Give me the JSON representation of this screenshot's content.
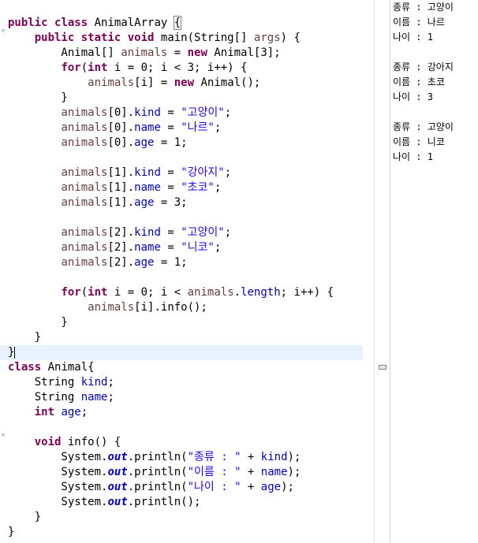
{
  "editor": {
    "lines": [
      [
        {
          "t": "public",
          "c": "kw"
        },
        {
          "t": " "
        },
        {
          "t": "class",
          "c": "kw"
        },
        {
          "t": " AnimalArray "
        },
        {
          "t": "{",
          "c": "bracket"
        }
      ],
      [
        {
          "t": "    "
        },
        {
          "t": "public",
          "c": "kw"
        },
        {
          "t": " "
        },
        {
          "t": "static",
          "c": "kw"
        },
        {
          "t": " "
        },
        {
          "t": "void",
          "c": "kw"
        },
        {
          "t": " main(String[] "
        },
        {
          "t": "args",
          "c": "var"
        },
        {
          "t": ") {"
        }
      ],
      [
        {
          "t": "        Animal[] "
        },
        {
          "t": "animals",
          "c": "var"
        },
        {
          "t": " = "
        },
        {
          "t": "new",
          "c": "kw"
        },
        {
          "t": " Animal[3];"
        }
      ],
      [
        {
          "t": "        "
        },
        {
          "t": "for",
          "c": "kw"
        },
        {
          "t": "("
        },
        {
          "t": "int",
          "c": "kw"
        },
        {
          "t": " i = 0; i < 3; i++) {"
        }
      ],
      [
        {
          "t": "            "
        },
        {
          "t": "animals",
          "c": "var"
        },
        {
          "t": "[i] = "
        },
        {
          "t": "new",
          "c": "kw"
        },
        {
          "t": " Animal();"
        }
      ],
      [
        {
          "t": "        }"
        }
      ],
      [
        {
          "t": "        "
        },
        {
          "t": "animals",
          "c": "var"
        },
        {
          "t": "[0]."
        },
        {
          "t": "kind",
          "c": "fld"
        },
        {
          "t": " = "
        },
        {
          "t": "\"고양이\"",
          "c": "str"
        },
        {
          "t": ";"
        }
      ],
      [
        {
          "t": "        "
        },
        {
          "t": "animals",
          "c": "var"
        },
        {
          "t": "[0]."
        },
        {
          "t": "name",
          "c": "fld"
        },
        {
          "t": " = "
        },
        {
          "t": "\"나르\"",
          "c": "str"
        },
        {
          "t": ";"
        }
      ],
      [
        {
          "t": "        "
        },
        {
          "t": "animals",
          "c": "var"
        },
        {
          "t": "[0]."
        },
        {
          "t": "age",
          "c": "fld"
        },
        {
          "t": " = 1;"
        }
      ],
      [],
      [
        {
          "t": "        "
        },
        {
          "t": "animals",
          "c": "var"
        },
        {
          "t": "[1]."
        },
        {
          "t": "kind",
          "c": "fld"
        },
        {
          "t": " = "
        },
        {
          "t": "\"강아지\"",
          "c": "str"
        },
        {
          "t": ";"
        }
      ],
      [
        {
          "t": "        "
        },
        {
          "t": "animals",
          "c": "var"
        },
        {
          "t": "[1]."
        },
        {
          "t": "name",
          "c": "fld"
        },
        {
          "t": " = "
        },
        {
          "t": "\"초코\"",
          "c": "str"
        },
        {
          "t": ";"
        }
      ],
      [
        {
          "t": "        "
        },
        {
          "t": "animals",
          "c": "var"
        },
        {
          "t": "[1]."
        },
        {
          "t": "age",
          "c": "fld"
        },
        {
          "t": " = 3;"
        }
      ],
      [],
      [
        {
          "t": "        "
        },
        {
          "t": "animals",
          "c": "var"
        },
        {
          "t": "[2]."
        },
        {
          "t": "kind",
          "c": "fld"
        },
        {
          "t": " = "
        },
        {
          "t": "\"고양이\"",
          "c": "str"
        },
        {
          "t": ";"
        }
      ],
      [
        {
          "t": "        "
        },
        {
          "t": "animals",
          "c": "var"
        },
        {
          "t": "[2]."
        },
        {
          "t": "name",
          "c": "fld"
        },
        {
          "t": " = "
        },
        {
          "t": "\"니코\"",
          "c": "str"
        },
        {
          "t": ";"
        }
      ],
      [
        {
          "t": "        "
        },
        {
          "t": "animals",
          "c": "var"
        },
        {
          "t": "[2]."
        },
        {
          "t": "age",
          "c": "fld"
        },
        {
          "t": " = 1;"
        }
      ],
      [],
      [
        {
          "t": "        "
        },
        {
          "t": "for",
          "c": "kw"
        },
        {
          "t": "("
        },
        {
          "t": "int",
          "c": "kw"
        },
        {
          "t": " i = 0; i < "
        },
        {
          "t": "animals",
          "c": "var"
        },
        {
          "t": "."
        },
        {
          "t": "length",
          "c": "fld"
        },
        {
          "t": "; i++) {"
        }
      ],
      [
        {
          "t": "            "
        },
        {
          "t": "animals",
          "c": "var"
        },
        {
          "t": "[i].info();"
        }
      ],
      [
        {
          "t": "        }"
        }
      ],
      [
        {
          "t": "    }"
        }
      ],
      [
        {
          "t": "}",
          "c": "caret-after"
        }
      ],
      [
        {
          "t": "class",
          "c": "kw"
        },
        {
          "t": " Animal{"
        }
      ],
      [
        {
          "t": "    String "
        },
        {
          "t": "kind",
          "c": "fld"
        },
        {
          "t": ";"
        }
      ],
      [
        {
          "t": "    String "
        },
        {
          "t": "name",
          "c": "fld"
        },
        {
          "t": ";"
        }
      ],
      [
        {
          "t": "    "
        },
        {
          "t": "int",
          "c": "kw"
        },
        {
          "t": " "
        },
        {
          "t": "age",
          "c": "fld"
        },
        {
          "t": ";"
        }
      ],
      [],
      [
        {
          "t": "    "
        },
        {
          "t": "void",
          "c": "kw"
        },
        {
          "t": " info() {"
        }
      ],
      [
        {
          "t": "        System."
        },
        {
          "t": "out",
          "c": "st"
        },
        {
          "t": ".println("
        },
        {
          "t": "\"종류 : \"",
          "c": "str"
        },
        {
          "t": " + "
        },
        {
          "t": "kind",
          "c": "fld"
        },
        {
          "t": ");"
        }
      ],
      [
        {
          "t": "        System."
        },
        {
          "t": "out",
          "c": "st"
        },
        {
          "t": ".println("
        },
        {
          "t": "\"이름 : \"",
          "c": "str"
        },
        {
          "t": " + "
        },
        {
          "t": "name",
          "c": "fld"
        },
        {
          "t": ");"
        }
      ],
      [
        {
          "t": "        System."
        },
        {
          "t": "out",
          "c": "st"
        },
        {
          "t": ".println("
        },
        {
          "t": "\"나이 : \"",
          "c": "str"
        },
        {
          "t": " + "
        },
        {
          "t": "age",
          "c": "fld"
        },
        {
          "t": ");"
        }
      ],
      [
        {
          "t": "        System."
        },
        {
          "t": "out",
          "c": "st"
        },
        {
          "t": ".println();"
        }
      ],
      [
        {
          "t": "    }"
        }
      ],
      [
        {
          "t": "}"
        }
      ]
    ],
    "current_line": 22,
    "fold_markers": [
      1,
      28
    ]
  },
  "console": {
    "lines": [
      "종류 : 고양이",
      "이름 : 나르",
      "나이 : 1",
      "",
      "종류 : 강아지",
      "이름 : 초코",
      "나이 : 3",
      "",
      "종류 : 고양이",
      "이름 : 니코",
      "나이 : 1"
    ]
  },
  "icons": {
    "fold": "minus-collapse-icon",
    "minimize": "minimize-icon"
  },
  "colors": {
    "keyword": "#7f0055",
    "field": "#0000c0",
    "local_var": "#6a3e3e",
    "string": "#2a00ff",
    "current_line_bg": "#e8f2fe"
  }
}
